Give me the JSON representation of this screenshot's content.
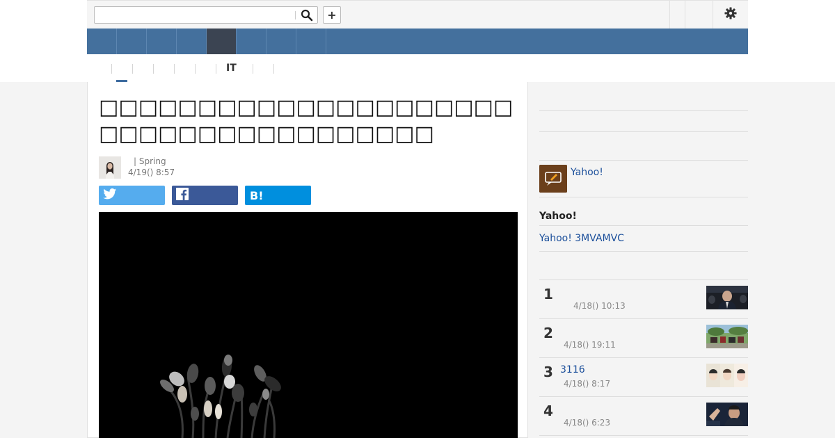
{
  "search": {
    "value": "",
    "placeholder": ""
  },
  "header": {
    "add_label": "+"
  },
  "nav": {
    "items": [
      "",
      "",
      "",
      "",
      "",
      "",
      "",
      "",
      ""
    ]
  },
  "subnav": {
    "label": "IT"
  },
  "article": {
    "headline": "□□□□□□□□□□□□□□□□□□□□□□□□□□□□□□□□□□□□□□",
    "byline": "| Spring",
    "date": "4/19() 8:57",
    "share": {
      "twitter": "",
      "facebook": "",
      "hatena": "B!"
    }
  },
  "sidebar": {
    "author_name": "Yahoo!",
    "section_title": "Yahoo!",
    "link_text": "Yahoo! 3MVAMVC",
    "ranking": [
      {
        "rank": "1",
        "title": "",
        "date": "4/18() 10:13"
      },
      {
        "rank": "2",
        "title": "",
        "date": "4/18() 19:11"
      },
      {
        "rank": "3",
        "title": "3116",
        "date": "4/18() 8:17"
      },
      {
        "rank": "4",
        "title": "",
        "date": "4/18() 6:23"
      }
    ]
  },
  "colors": {
    "nav": "#44709d",
    "nav_active": "#3b4452",
    "twitter": "#55acee",
    "facebook": "#3b5998",
    "hatena": "#008fde",
    "link": "#1a4e9a"
  }
}
